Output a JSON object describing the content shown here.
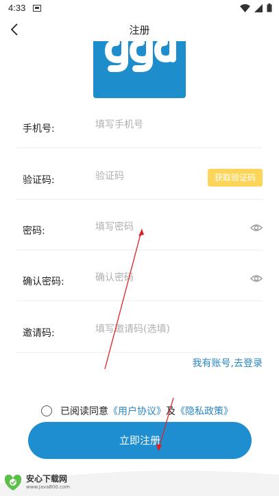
{
  "status_bar": {
    "time": "4:33"
  },
  "nav": {
    "title": "注册"
  },
  "logo": {
    "text": "ggd"
  },
  "form": {
    "phone": {
      "label": "手机号:",
      "placeholder": "填写手机号"
    },
    "code": {
      "label": "验证码:",
      "placeholder": "验证码",
      "button": "获取验证码"
    },
    "password": {
      "label": "密码:",
      "placeholder": "填写密码"
    },
    "confirm": {
      "label": "确认密码:",
      "placeholder": "确认密码"
    },
    "invite": {
      "label": "邀请码:",
      "placeholder": "填写邀请码(选填)"
    }
  },
  "login_link": "我有账号,去登录",
  "agreement": {
    "prefix": "已阅读同意",
    "user_agreement": "《用户协议》",
    "and": "及",
    "privacy": "《隐私政策》"
  },
  "register_button": "立即注册",
  "watermark": {
    "title": "安心下载网",
    "url": "www.java800.com"
  },
  "colors": {
    "primary": "#1e8ed1",
    "link": "#2a87c4",
    "code_button": "#fcd55a",
    "annotation": "#e02020"
  }
}
